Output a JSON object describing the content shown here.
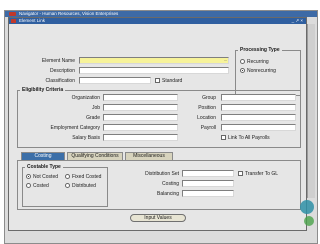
{
  "navigator_title": "Navigator - Human Resources, Vision Enterprises",
  "element_window": {
    "title": "Element Link",
    "title_controls": "_ ↗ ×"
  },
  "form": {
    "element_name_label": "Element Name",
    "description_label": "Description",
    "classification_label": "Classification",
    "standard_label": "Standard",
    "lov_glyph": "..."
  },
  "processing_type": {
    "title": "Processing Type",
    "options": [
      {
        "label": "Recurring",
        "selected": false
      },
      {
        "label": "Nonrecurring",
        "selected": true
      }
    ]
  },
  "eligibility": {
    "title": "Eligibility Criteria",
    "left_labels": [
      "Organization",
      "Job",
      "Grade",
      "Employment Category",
      "Salary Basis"
    ],
    "right_labels": [
      "Group",
      "Position",
      "Location",
      "Payroll"
    ],
    "link_label": "Link To All Payrolls"
  },
  "tabs": [
    {
      "label": "Costing",
      "active": true
    },
    {
      "label": "Qualifying Conditions",
      "active": false
    },
    {
      "label": "Miscellaneous",
      "active": false
    }
  ],
  "costable": {
    "title": "Costable Type",
    "options": [
      {
        "label": "Not Costed",
        "selected": true
      },
      {
        "label": "Fixed Costed",
        "selected": false
      },
      {
        "label": "Costed",
        "selected": false
      },
      {
        "label": "Distributed",
        "selected": false
      }
    ]
  },
  "costing": {
    "distribution_label": "Distribution Set",
    "costing_label": "Costing",
    "balancing_label": "Balancing",
    "transfer_label": "Transfer To GL"
  },
  "input_values_button": "Input Values",
  "colors": {
    "title_bar": "#2f5fa0",
    "window_bg": "#e6e6e6",
    "required_field": "#f7f39a",
    "active_tab": "#3c6fa8"
  }
}
